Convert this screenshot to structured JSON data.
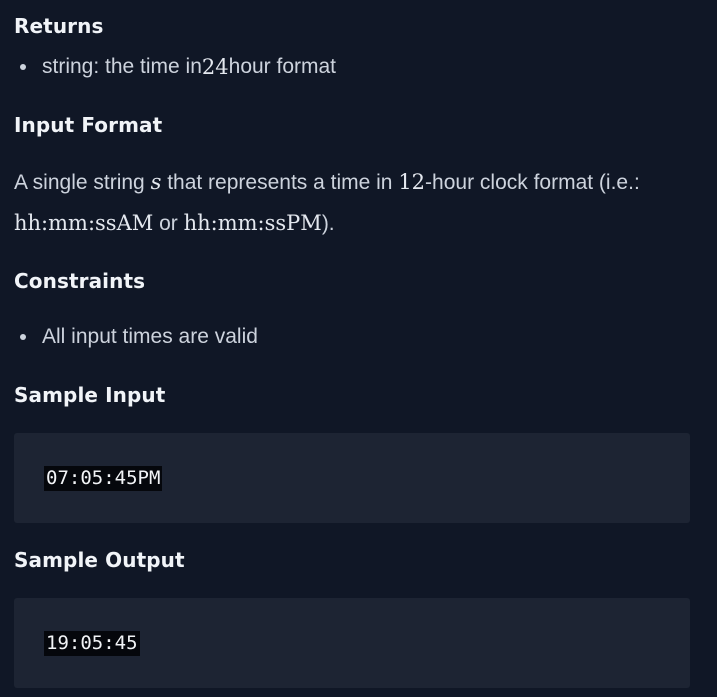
{
  "returns": {
    "heading": "Returns",
    "bullet": {
      "prefix": "string: the time in ",
      "math": "24",
      "suffix": " hour format"
    }
  },
  "input_format": {
    "heading": "Input Format",
    "line1": {
      "t1": "A single string ",
      "var": "s",
      "t2": " that represents a time in ",
      "num": "12",
      "t3": "-hour clock format (i.e.:"
    },
    "line2": {
      "format_am": "hh:mm:ssAM",
      "or": " or ",
      "format_pm": "hh:mm:ssPM",
      "end": ")."
    }
  },
  "constraints": {
    "heading": "Constraints",
    "items": [
      "All input times are valid"
    ]
  },
  "sample_input": {
    "heading": "Sample Input",
    "code": "07:05:45PM"
  },
  "sample_output": {
    "heading": "Sample Output",
    "code": "19:05:45"
  }
}
